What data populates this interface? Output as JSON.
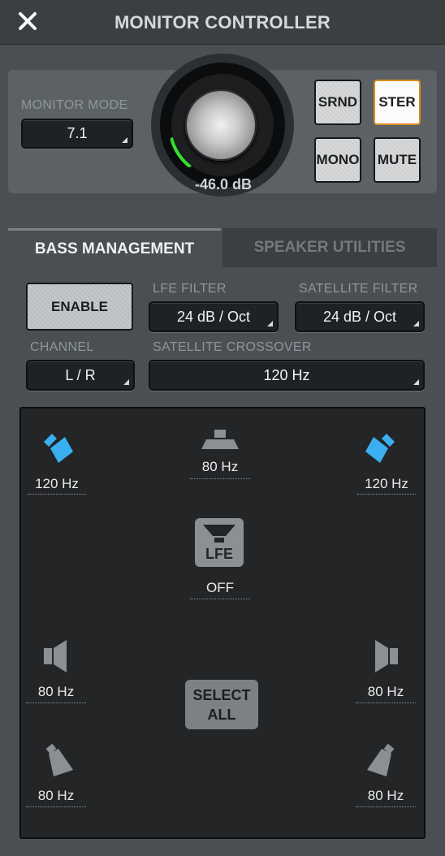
{
  "window": {
    "title": "MONITOR CONTROLLER",
    "close_icon": "close-icon"
  },
  "monitor": {
    "mode_label": "MONITOR MODE",
    "mode_value": "7.1",
    "level_text": "-46.0 dB",
    "level_fraction": 0.12,
    "meter_color": "#36e02a",
    "buttons": {
      "srnd": "SRND",
      "ster": "STER",
      "mono": "MONO",
      "mute": "MUTE"
    },
    "active_button": "STER",
    "active_color": "#d98a1d"
  },
  "tabs": {
    "bass": "BASS MANAGEMENT",
    "speaker": "SPEAKER UTILITIES",
    "selected": "BASS MANAGEMENT"
  },
  "bass": {
    "enable_label": "ENABLE",
    "lfe_filter_label": "LFE FILTER",
    "lfe_filter_value": "24 dB / Oct",
    "sat_filter_label": "SATELLITE FILTER",
    "sat_filter_value": "24 dB / Oct",
    "channel_label": "CHANNEL",
    "channel_value": "L / R",
    "crossover_label": "SATELLITE CROSSOVER",
    "crossover_value": "120 Hz"
  },
  "speakers": {
    "front_left": "120 Hz",
    "center": "80 Hz",
    "front_right": "120 Hz",
    "lfe_label": "LFE",
    "lfe_value": "OFF",
    "side_left": "80 Hz",
    "side_right": "80 Hz",
    "rear_left": "80 Hz",
    "rear_right": "80 Hz",
    "select_all_line1": "SELECT",
    "select_all_line2": "ALL",
    "selected_color": "#3ab0f0",
    "unselected_color": "#8a9094"
  }
}
